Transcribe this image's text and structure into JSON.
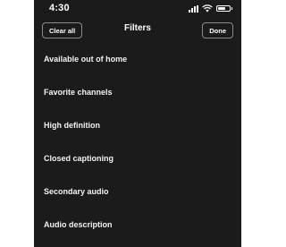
{
  "status_bar": {
    "time": "4:30",
    "battery_level": 0.7
  },
  "header": {
    "clear_label": "Clear all",
    "title": "Filters",
    "done_label": "Done"
  },
  "filters": [
    {
      "label": "Available out of home"
    },
    {
      "label": "Favorite channels"
    },
    {
      "label": "High definition"
    },
    {
      "label": "Closed captioning"
    },
    {
      "label": "Secondary audio"
    },
    {
      "label": "Audio description"
    }
  ],
  "colors": {
    "background": "#1b1b1b",
    "text": "#ffffff",
    "button_border": "#8a8a8a"
  }
}
